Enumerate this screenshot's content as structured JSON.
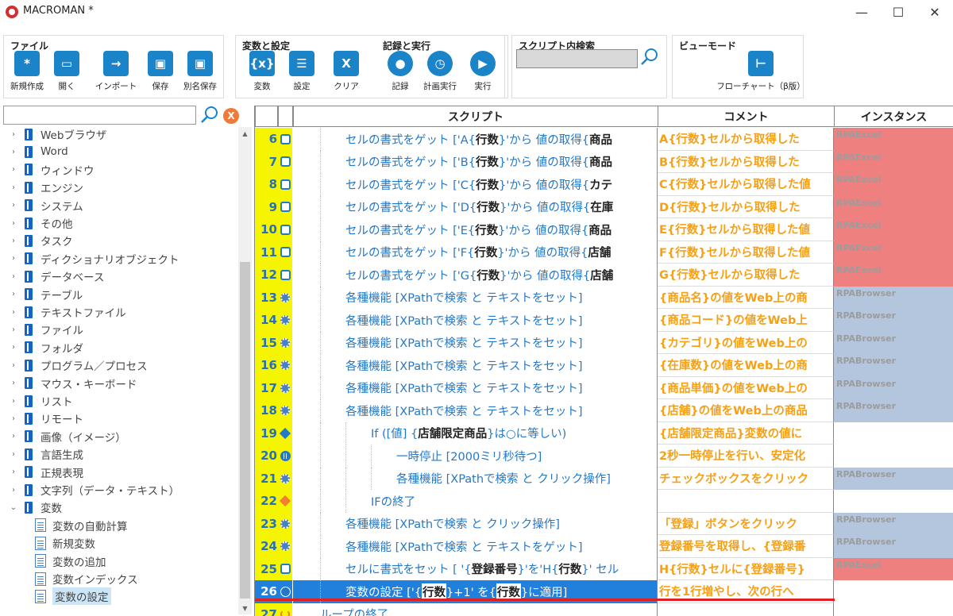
{
  "window": {
    "title": "MACROMAN *",
    "controls": {
      "minimize": "—",
      "maximize": "☐",
      "close": "✕"
    }
  },
  "ribbon": {
    "groups": [
      {
        "title": "ファイル",
        "buttons": [
          {
            "label": "新規作成",
            "icon": "*",
            "icon_name": "new-file-icon"
          },
          {
            "label": "開く",
            "icon": "▭",
            "icon_name": "folder-icon"
          },
          {
            "label": "インポート",
            "icon": "→",
            "icon_name": "import-arrow-icon"
          },
          {
            "label": "保存",
            "icon": "▣",
            "icon_name": "save-disk-icon"
          },
          {
            "label": "別名保存",
            "icon": "▣",
            "icon_name": "save-as-disk-icon"
          }
        ]
      },
      {
        "title": "変数と設定",
        "buttons": [
          {
            "label": "変数",
            "icon": "{x}",
            "icon_name": "variable-icon"
          },
          {
            "label": "設定",
            "icon": "☰",
            "icon_name": "settings-list-icon"
          },
          {
            "label": "クリア",
            "icon": "X",
            "icon_name": "clear-x-icon"
          }
        ]
      },
      {
        "title": "記録と実行",
        "buttons": [
          {
            "label": "記録",
            "icon": "●",
            "icon_name": "record-icon"
          },
          {
            "label": "計画実行",
            "icon": "◷",
            "icon_name": "schedule-clock-icon"
          },
          {
            "label": "実行",
            "icon": "▶",
            "icon_name": "play-icon"
          }
        ]
      },
      {
        "title": "スクリプト内検索",
        "buttons": []
      },
      {
        "title": "ビューモード",
        "buttons": [
          {
            "label": "フローチャート（β版）",
            "icon": "⊢",
            "icon_name": "flowchart-icon"
          }
        ]
      }
    ],
    "search_value": ""
  },
  "tree": {
    "search_value": "",
    "clear_label": "X",
    "items": [
      {
        "label": "Webブラウザ",
        "toggle": "›"
      },
      {
        "label": "Word",
        "toggle": "›"
      },
      {
        "label": "ウィンドウ",
        "toggle": "›"
      },
      {
        "label": "エンジン",
        "toggle": "›"
      },
      {
        "label": "システム",
        "toggle": "›"
      },
      {
        "label": "その他",
        "toggle": "›"
      },
      {
        "label": "タスク",
        "toggle": "›"
      },
      {
        "label": "ディクショナリオブジェクト",
        "toggle": "›"
      },
      {
        "label": "データベース",
        "toggle": "›"
      },
      {
        "label": "テーブル",
        "toggle": "›"
      },
      {
        "label": "テキストファイル",
        "toggle": "›"
      },
      {
        "label": "ファイル",
        "toggle": "›"
      },
      {
        "label": "フォルダ",
        "toggle": "›"
      },
      {
        "label": "プログラム／プロセス",
        "toggle": "›"
      },
      {
        "label": "マウス・キーボード",
        "toggle": "›"
      },
      {
        "label": "リスト",
        "toggle": "›"
      },
      {
        "label": "リモート",
        "toggle": "›"
      },
      {
        "label": "画像（イメージ）",
        "toggle": "›"
      },
      {
        "label": "言語生成",
        "toggle": "›"
      },
      {
        "label": "正規表現",
        "toggle": "›"
      },
      {
        "label": "文字列（データ・テキスト）",
        "toggle": "›"
      },
      {
        "label": "変数",
        "toggle": "⌄"
      }
    ],
    "children": [
      {
        "label": "変数の自動計算"
      },
      {
        "label": "新規変数"
      },
      {
        "label": "変数の追加"
      },
      {
        "label": "変数インデックス"
      },
      {
        "label": "変数の設定",
        "selected": true
      }
    ]
  },
  "grid": {
    "headers": {
      "script": "スクリプト",
      "comment": "コメント",
      "instance": "インスタンス"
    },
    "rows": [
      {
        "num": "6",
        "icon": "doc",
        "indent": 1,
        "parts": [
          "セルの書式をゲット ['A{",
          "行数",
          "}'から 値の取得{",
          "商品"
        ],
        "comment": "A{行数}セルから取得した",
        "instance": "RPAExcel",
        "inst_color": "#ee8080"
      },
      {
        "num": "7",
        "icon": "doc",
        "indent": 1,
        "parts": [
          "セルの書式をゲット ['B{",
          "行数",
          "}'から 値の取得{",
          "商品"
        ],
        "comment": "B{行数}セルから取得した",
        "instance": "RPAExcel",
        "inst_color": "#ee8080"
      },
      {
        "num": "8",
        "icon": "doc",
        "indent": 1,
        "parts": [
          "セルの書式をゲット ['C{",
          "行数",
          "}'から 値の取得{",
          "カテ"
        ],
        "comment": "C{行数}セルから取得した値",
        "instance": "RPAExcel",
        "inst_color": "#ee8080"
      },
      {
        "num": "9",
        "icon": "doc",
        "indent": 1,
        "parts": [
          "セルの書式をゲット ['D{",
          "行数",
          "}'から 値の取得{",
          "在庫"
        ],
        "comment": "D{行数}セルから取得した",
        "instance": "RPAExcel",
        "inst_color": "#ee8080"
      },
      {
        "num": "10",
        "icon": "doc",
        "indent": 1,
        "parts": [
          "セルの書式をゲット ['E{",
          "行数",
          "}'から 値の取得{",
          "商品"
        ],
        "comment": "E{行数}セルから取得した値",
        "instance": "RPAExcel",
        "inst_color": "#ee8080"
      },
      {
        "num": "11",
        "icon": "doc",
        "indent": 1,
        "parts": [
          "セルの書式をゲット ['F{",
          "行数",
          "}'から 値の取得{",
          "店舗"
        ],
        "comment": "F{行数}セルから取得した値",
        "instance": "RPAExcel",
        "inst_color": "#ee8080"
      },
      {
        "num": "12",
        "icon": "doc",
        "indent": 1,
        "parts": [
          "セルの書式をゲット ['G{",
          "行数",
          "}'から 値の取得{",
          "店舗"
        ],
        "comment": "G{行数}セルから取得した",
        "instance": "RPAExcel",
        "inst_color": "#ee8080"
      },
      {
        "num": "13",
        "icon": "gear",
        "indent": 1,
        "parts": [
          "各種機能 [XPathで検索 と テキストをセット]"
        ],
        "comment": "{商品名}の値をWeb上の商",
        "instance": "RPABrowser",
        "inst_color": "#b3c6de"
      },
      {
        "num": "14",
        "icon": "gear",
        "indent": 1,
        "parts": [
          "各種機能 [XPathで検索 と テキストをセット]"
        ],
        "comment": "{商品コード}の値をWeb上",
        "instance": "RPABrowser",
        "inst_color": "#b3c6de"
      },
      {
        "num": "15",
        "icon": "gear",
        "indent": 1,
        "parts": [
          "各種機能 [XPathで検索 と テキストをセット]"
        ],
        "comment": "{カテゴリ}の値をWeb上の",
        "instance": "RPABrowser",
        "inst_color": "#b3c6de"
      },
      {
        "num": "16",
        "icon": "gear",
        "indent": 1,
        "parts": [
          "各種機能 [XPathで検索 と テキストをセット]"
        ],
        "comment": "{在庫数}の値をWeb上の商",
        "instance": "RPABrowser",
        "inst_color": "#b3c6de"
      },
      {
        "num": "17",
        "icon": "gear",
        "indent": 1,
        "parts": [
          "各種機能 [XPathで検索 と テキストをセット]"
        ],
        "comment": "{商品単価}の値をWeb上の",
        "instance": "RPABrowser",
        "inst_color": "#b3c6de"
      },
      {
        "num": "18",
        "icon": "gear",
        "indent": 1,
        "parts": [
          "各種機能 [XPathで検索 と テキストをセット]"
        ],
        "comment": "{店舗}の値をWeb上の商品",
        "instance": "RPABrowser",
        "inst_color": "#b3c6de"
      },
      {
        "num": "19",
        "icon": "dia-blue",
        "indent": 2,
        "parts": [
          "If ([値] {",
          "店舗限定商品",
          "}は○に等しい)"
        ],
        "comment": "{店舗限定商品}変数の値に",
        "instance": "",
        "inst_color": ""
      },
      {
        "num": "20",
        "icon": "pause",
        "indent": 3,
        "parts": [
          "一時停止 [2000ミリ秒待つ]"
        ],
        "comment": "2秒一時停止を行い、安定化",
        "instance": "",
        "inst_color": ""
      },
      {
        "num": "21",
        "icon": "gear",
        "indent": 3,
        "parts": [
          "各種機能 [XPathで検索 と クリック操作]"
        ],
        "comment": "チェックボックスをクリック",
        "instance": "RPABrowser",
        "inst_color": "#b3c6de"
      },
      {
        "num": "22",
        "icon": "dia-or",
        "indent": 2,
        "parts": [
          "IFの終了"
        ],
        "comment": "",
        "instance": "",
        "inst_color": ""
      },
      {
        "num": "23",
        "icon": "gear",
        "indent": 1,
        "parts": [
          "各種機能 [XPathで検索 と クリック操作]"
        ],
        "comment": "「登録」ボタンをクリック",
        "instance": "RPABrowser",
        "inst_color": "#b3c6de"
      },
      {
        "num": "24",
        "icon": "gear",
        "indent": 1,
        "parts": [
          "各種機能 [XPathで検索 と テキストをゲット]"
        ],
        "comment": "登録番号を取得し、{登録番",
        "instance": "RPABrowser",
        "inst_color": "#b3c6de"
      },
      {
        "num": "25",
        "icon": "doc",
        "indent": 1,
        "parts": [
          "セルに書式をセット [ '{",
          "登録番号",
          "}'を'H{",
          "行数",
          "}' セル"
        ],
        "comment": "H{行数}セルに{登録番号}",
        "instance": "RPAExcel",
        "inst_color": "#ee8080"
      },
      {
        "num": "26",
        "icon": "info",
        "indent": 1,
        "parts": [
          "変数の設定 ['{",
          "行数",
          "}+1' を{",
          "行数",
          "}に適用]"
        ],
        "comment": "行を1行増やし、次の行へ",
        "instance": "",
        "inst_color": "",
        "selected": true
      },
      {
        "num": "27",
        "icon": "loop",
        "indent": 0,
        "parts": [
          "ループの終了"
        ],
        "comment": "",
        "instance": "",
        "inst_color": ""
      }
    ]
  }
}
